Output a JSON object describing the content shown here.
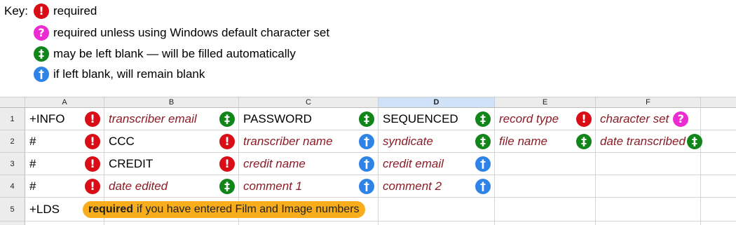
{
  "key": {
    "title": "Key:",
    "items": [
      {
        "icon": "exclamation-icon",
        "glyph": "!",
        "color": "#d90d16",
        "label": "required"
      },
      {
        "icon": "question-icon",
        "glyph": "?",
        "color": "#ea2cd2",
        "label": "required unless using Windows default character set"
      },
      {
        "icon": "double-dagger-icon",
        "glyph": "‡",
        "color": "#12851a",
        "label": "may be left blank — will be filled automatically"
      },
      {
        "icon": "dagger-icon",
        "glyph": "†",
        "color": "#2f82e6",
        "label": "if left blank, will remain blank"
      }
    ]
  },
  "sheet": {
    "columns": [
      "A",
      "B",
      "C",
      "D",
      "E",
      "F"
    ],
    "selected_column": "D",
    "rows": [
      "1",
      "2",
      "3",
      "4",
      "5"
    ],
    "cells": {
      "r1": {
        "a": {
          "text": "+INFO",
          "glyph": "!"
        },
        "b": {
          "text": "transcriber email",
          "glyph": "‡"
        },
        "c": {
          "text": "PASSWORD",
          "glyph": "‡"
        },
        "d": {
          "text": "SEQUENCED",
          "glyph": "‡"
        },
        "e": {
          "text": "record type",
          "glyph": "!"
        },
        "f": {
          "text": "character set",
          "glyph": "?"
        }
      },
      "r2": {
        "a": {
          "text": "#",
          "glyph": "!"
        },
        "b": {
          "text": "CCC",
          "glyph": "!"
        },
        "c": {
          "text": "transcriber name",
          "glyph": "†"
        },
        "d": {
          "text": "syndicate",
          "glyph": "‡"
        },
        "e": {
          "text": "file name",
          "glyph": "‡"
        },
        "f": {
          "text": "date transcribed",
          "glyph": "‡"
        }
      },
      "r3": {
        "a": {
          "text": "#",
          "glyph": "!"
        },
        "b": {
          "text": "CREDIT",
          "glyph": "!"
        },
        "c": {
          "text": "credit name",
          "glyph": "†"
        },
        "d": {
          "text": "credit email",
          "glyph": "†"
        }
      },
      "r4": {
        "a": {
          "text": "#",
          "glyph": "!"
        },
        "b": {
          "text": "date edited",
          "glyph": "‡"
        },
        "c": {
          "text": "comment 1",
          "glyph": "†"
        },
        "d": {
          "text": "comment 2",
          "glyph": "†"
        }
      },
      "r5": {
        "a": {
          "text": "+LDS"
        }
      }
    },
    "note": {
      "bold": "required",
      "rest": "if you have entered Film and Image numbers"
    }
  }
}
